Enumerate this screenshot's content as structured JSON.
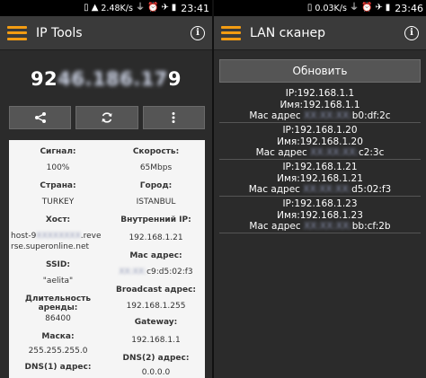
{
  "status_left": {
    "speed": "2.48K/s",
    "time": "23:41"
  },
  "status_right": {
    "speed": "0.03K/s",
    "time": "23:46"
  },
  "left_app": {
    "title": "IP Tools",
    "ip_visible_prefix": "92",
    "ip_visible_suffix": "9",
    "ip_blurred": "46.186.17",
    "fields": [
      {
        "label": "Сигнал:",
        "value": "100%"
      },
      {
        "label": "Скорость:",
        "value": "65Mbps"
      },
      {
        "label": "Страна:",
        "value": "TURKEY"
      },
      {
        "label": "Город:",
        "value": "ISTANBUL"
      },
      {
        "label": "Хост:",
        "value_line1_visible": "host-9",
        "value_line1_blurred": "XXXXXXXX",
        "value_line1_suffix": ".reve",
        "value_line2": "rse.superonline.net"
      },
      {
        "label": "Внутренний IP:",
        "value": "192.168.1.21"
      },
      {
        "label": "SSID:",
        "value": "\"aelita\""
      },
      {
        "label": "Мас адрес:",
        "value_blurred": "XX:XX:",
        "value_suffix": "c9:d5:02:f3"
      },
      {
        "label": "Длительность аренды:",
        "value": "86400"
      },
      {
        "label": "Broadcast адрес:",
        "value": "192.168.1.255"
      },
      {
        "label": "Маска:",
        "value": "255.255.255.0"
      },
      {
        "label": "Gateway:",
        "value": "192.168.1.1"
      },
      {
        "label": "DNS(1) адрес:",
        "value": ""
      },
      {
        "label": "DNS(2) адрес:",
        "value": "0.0.0.0"
      }
    ]
  },
  "right_app": {
    "title": "LAN сканер",
    "refresh_label": "Обновить",
    "devices": [
      {
        "ip": "IP:192.168.1.1",
        "name": "Имя:192.168.1.1",
        "mac_prefix": "Мас адрес",
        "mac_blurred": "XX:XX:XX:",
        "mac_suffix": "b0:df:2c"
      },
      {
        "ip": "IP:192.168.1.20",
        "name": "Имя:192.168.1.20",
        "mac_prefix": "Мас адрес",
        "mac_blurred": "XX:XX:XX:",
        "mac_suffix": "c2:3c"
      },
      {
        "ip": "IP:192.168.1.21",
        "name": "Имя:192.168.1.21",
        "mac_prefix": "Мас адрес",
        "mac_blurred": "XX:XX:XX:",
        "mac_suffix": "d5:02:f3"
      },
      {
        "ip": "IP:192.168.1.23",
        "name": "Имя:192.168.1.23",
        "mac_prefix": "Мас адрес",
        "mac_blurred": "XX:XX:XX:",
        "mac_suffix": "bb:cf:2b"
      }
    ]
  },
  "icons": {
    "hamburger": "hamburger-menu-icon",
    "info": "info-icon",
    "share": "share-icon",
    "refresh": "refresh-icon",
    "more": "more-vertical-icon"
  },
  "colors": {
    "accent": "#f39c12",
    "appbar": "#3a3a3a",
    "background": "#2b2b2b",
    "card": "#f5f5f5"
  }
}
